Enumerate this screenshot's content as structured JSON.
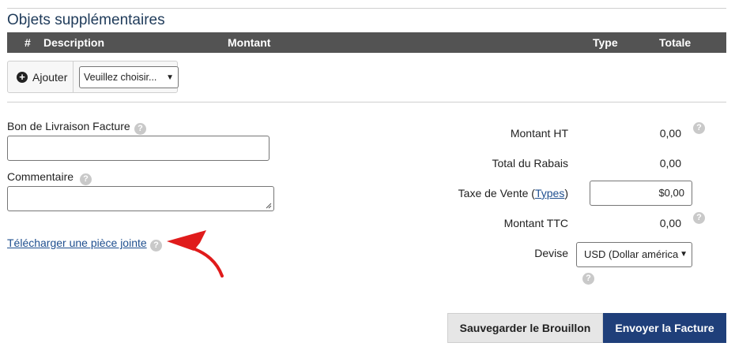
{
  "section_title": "Objets supplémentaires",
  "table_headers": {
    "num": "#",
    "description": "Description",
    "amount": "Montant",
    "type": "Type",
    "total": "Totale"
  },
  "add_button": "Ajouter",
  "add_select": "Veuillez choisir...",
  "delivery_label": "Bon de Livraison Facture",
  "comment_label": "Commentaire",
  "upload_link": "Télécharger une pièce jointe",
  "summary": {
    "amount_ht_label": "Montant HT",
    "amount_ht_value": "0,00",
    "discount_label": "Total du Rabais",
    "discount_value": "0,00",
    "tax_label_prefix": "Taxe de Vente (",
    "tax_label_link": "Types",
    "tax_label_suffix": ")",
    "tax_value": "$0,00",
    "amount_ttc_label": "Montant TTC",
    "amount_ttc_value": "0,00",
    "currency_label": "Devise",
    "currency_value": "USD (Dollar américa"
  },
  "buttons": {
    "save_draft": "Sauvegarder le Brouillon",
    "send_invoice": "Envoyer la Facture"
  },
  "colors": {
    "header_bg": "#535353",
    "primary_button": "#1f3f7a",
    "annotation_arrow": "#e01b1b"
  },
  "icons": {
    "add": "plus-circle-icon",
    "help": "question-circle-icon",
    "dropdown": "chevron-down-icon",
    "annotation": "red-arrow-icon"
  }
}
